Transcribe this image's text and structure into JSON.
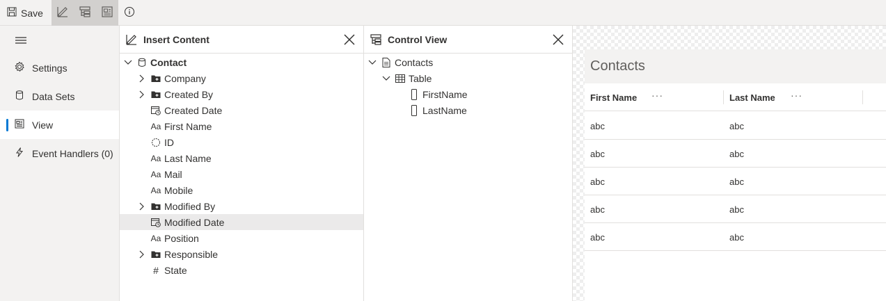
{
  "toolbar": {
    "save_label": "Save",
    "buttons": [
      "edit-content-icon",
      "control-tree-icon",
      "preview-icon"
    ],
    "info_icon": "info-icon"
  },
  "sidebar": {
    "items": [
      {
        "label": "Settings",
        "icon": "gear-icon"
      },
      {
        "label": "Data Sets",
        "icon": "database-icon"
      },
      {
        "label": "View",
        "icon": "view-icon",
        "active": true
      },
      {
        "label": "Event Handlers (0)",
        "icon": "lightning-icon"
      }
    ]
  },
  "insert_panel": {
    "title": "Insert Content",
    "root": "Contact",
    "fields": [
      {
        "label": "Company",
        "icon": "folder-icon",
        "expandable": true
      },
      {
        "label": "Created By",
        "icon": "folder-icon",
        "expandable": true
      },
      {
        "label": "Created Date",
        "icon": "calendar-clock-icon"
      },
      {
        "label": "First Name",
        "icon": "text-icon",
        "glyph": "Aa"
      },
      {
        "label": "ID",
        "icon": "id-icon"
      },
      {
        "label": "Last Name",
        "icon": "text-icon",
        "glyph": "Aa"
      },
      {
        "label": "Mail",
        "icon": "text-icon",
        "glyph": "Aa"
      },
      {
        "label": "Mobile",
        "icon": "text-icon",
        "glyph": "Aa"
      },
      {
        "label": "Modified By",
        "icon": "folder-icon",
        "expandable": true
      },
      {
        "label": "Modified Date",
        "icon": "calendar-clock-icon",
        "selected": true
      },
      {
        "label": "Position",
        "icon": "text-icon",
        "glyph": "Aa"
      },
      {
        "label": "Responsible",
        "icon": "folder-icon",
        "expandable": true
      },
      {
        "label": "State",
        "icon": "number-icon",
        "glyph": "#"
      }
    ]
  },
  "control_panel": {
    "title": "Control View",
    "root": "Contacts",
    "table": "Table",
    "columns": [
      "FirstName",
      "LastName"
    ]
  },
  "listview": {
    "title": "Contacts",
    "columns": [
      "First Name",
      "Last Name"
    ],
    "more_glyph": "···",
    "rows": [
      [
        "abc",
        "abc"
      ],
      [
        "abc",
        "abc"
      ],
      [
        "abc",
        "abc"
      ],
      [
        "abc",
        "abc"
      ],
      [
        "abc",
        "abc"
      ]
    ]
  }
}
